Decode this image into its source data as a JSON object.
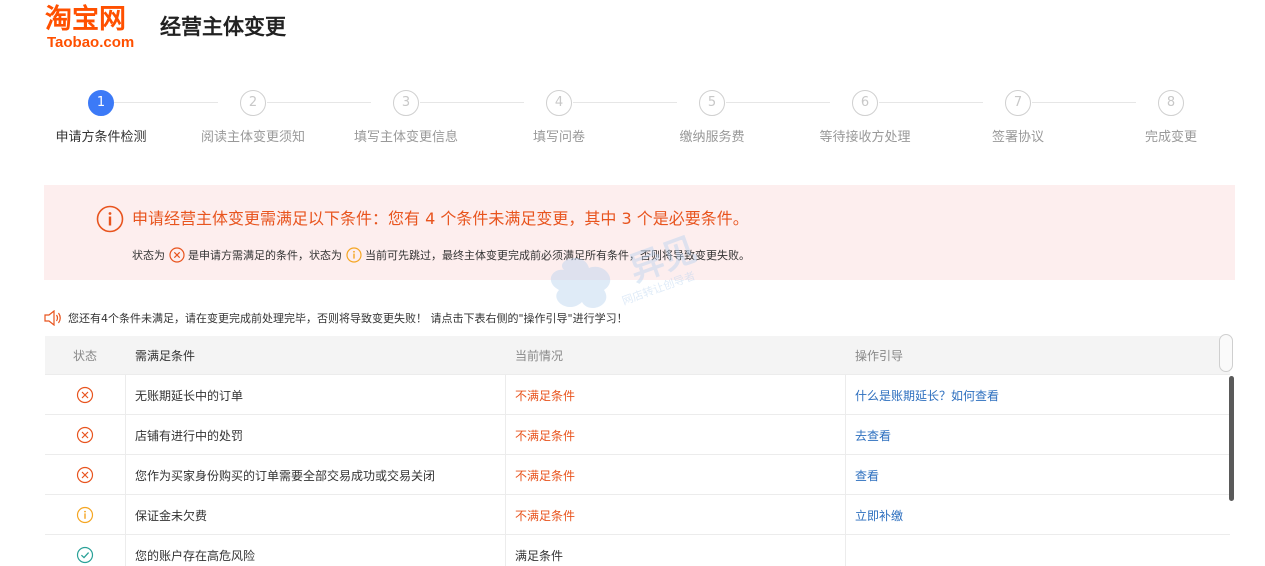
{
  "header": {
    "logo_cn": "淘宝网",
    "logo_en": "Taobao.com",
    "title": "经营主体变更"
  },
  "steps": [
    {
      "num": "1",
      "label": "申请方条件检测",
      "active": true
    },
    {
      "num": "2",
      "label": "阅读主体变更须知",
      "active": false
    },
    {
      "num": "3",
      "label": "填写主体变更信息",
      "active": false
    },
    {
      "num": "4",
      "label": "填写问卷",
      "active": false
    },
    {
      "num": "5",
      "label": "缴纳服务费",
      "active": false
    },
    {
      "num": "6",
      "label": "等待接收方处理",
      "active": false
    },
    {
      "num": "7",
      "label": "签署协议",
      "active": false
    },
    {
      "num": "8",
      "label": "完成变更",
      "active": false
    }
  ],
  "alert": {
    "title": "申请经营主体变更需满足以下条件：您有 4 个条件未满足变更，其中 3 个是必要条件。",
    "sub_part1": "状态为",
    "sub_part2": "是申请方需满足的条件，状态为",
    "sub_part3": "当前可先跳过，最终主体变更完成前必须满足所有条件，否则将导致变更失败。"
  },
  "watermark": {
    "main": "异见",
    "sub": "网店转让创导者"
  },
  "notice": {
    "text": "您还有4个条件未满足，请在变更完成前处理完毕，否则将导致变更失败！ 请点击下表右侧的\"操作引导\"进行学习！"
  },
  "table": {
    "headers": {
      "status": "状态",
      "condition": "需满足条件",
      "current": "当前情况",
      "guide": "操作引导"
    },
    "rows": [
      {
        "status_icon": "error-circle-icon",
        "condition": "无账期延长中的订单",
        "current": "不满足条件",
        "guide": "什么是账期延长？如何查看"
      },
      {
        "status_icon": "error-circle-icon",
        "condition": "店铺有进行中的处罚",
        "current": "不满足条件",
        "guide": "去查看"
      },
      {
        "status_icon": "error-circle-icon",
        "condition": "您作为买家身份购买的订单需要全部交易成功或交易关闭",
        "current": "不满足条件",
        "guide": "查看"
      },
      {
        "status_icon": "warning-circle-icon",
        "condition": "保证金未欠费",
        "current": "不满足条件",
        "guide": "立即补缴"
      },
      {
        "status_icon": "check-circle-icon",
        "condition": "您的账户存在高危风险",
        "current": "满足条件",
        "guide": ""
      }
    ]
  },
  "colors": {
    "brand": "#ff5000",
    "active_step": "#3c7af7",
    "alert_bg": "#fdeeee",
    "error": "#e8541e",
    "warning": "#f5a623",
    "success": "#2aa198",
    "link": "#2d6fbf"
  }
}
